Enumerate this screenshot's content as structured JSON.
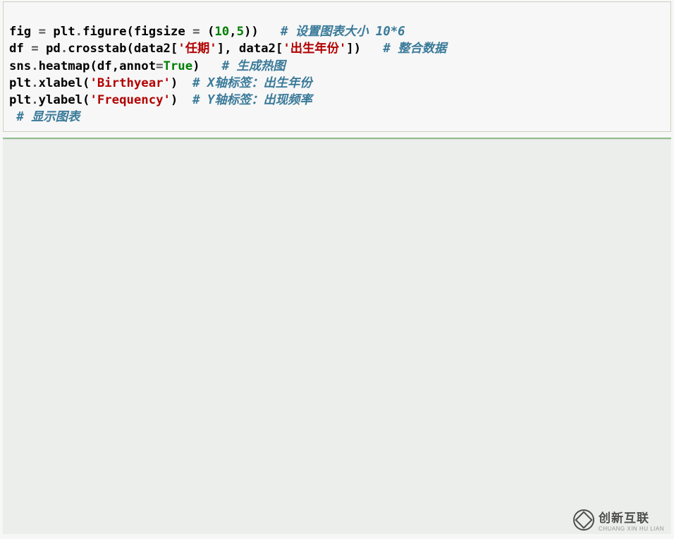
{
  "code": {
    "line1": {
      "a": "fig ",
      "b": "=",
      "c": " plt",
      "d": ".",
      "e": "figure(figsize ",
      "f": "=",
      "g": " (",
      "h": "10",
      "i": ",",
      "j": "5",
      "k": "))   ",
      "comm": "# 设置图表大小 10*6"
    },
    "line2": {
      "a": "df ",
      "b": "=",
      "c": " pd",
      "d": ".",
      "e": "crosstab(data2[",
      "f": "'任期'",
      "g": "], data2[",
      "h": "'出生年份'",
      "i": "])   ",
      "comm": "# 整合数据"
    },
    "line3": {
      "a": "sns",
      "b": ".",
      "c": "heatmap(df,annot",
      "d": "=",
      "e": "True",
      "f": ")   ",
      "comm": "# 生成热图"
    },
    "line4": {
      "a": "plt",
      "b": ".",
      "c": "xlabel(",
      "d": "'Birthyear'",
      "e": ")  ",
      "comm": "# X轴标签：出生年份"
    },
    "line5": {
      "a": "plt",
      "b": ".",
      "c": "ylabel(",
      "d": "'Frequency'",
      "e": ")  ",
      "comm": "# Y轴标签：出现频率"
    },
    "line6": {
      "a": " ",
      "comm": "# 显示图表"
    }
  },
  "watermark": {
    "cn": "创新互联",
    "en": "CHUANG XIN HU LIAN"
  }
}
